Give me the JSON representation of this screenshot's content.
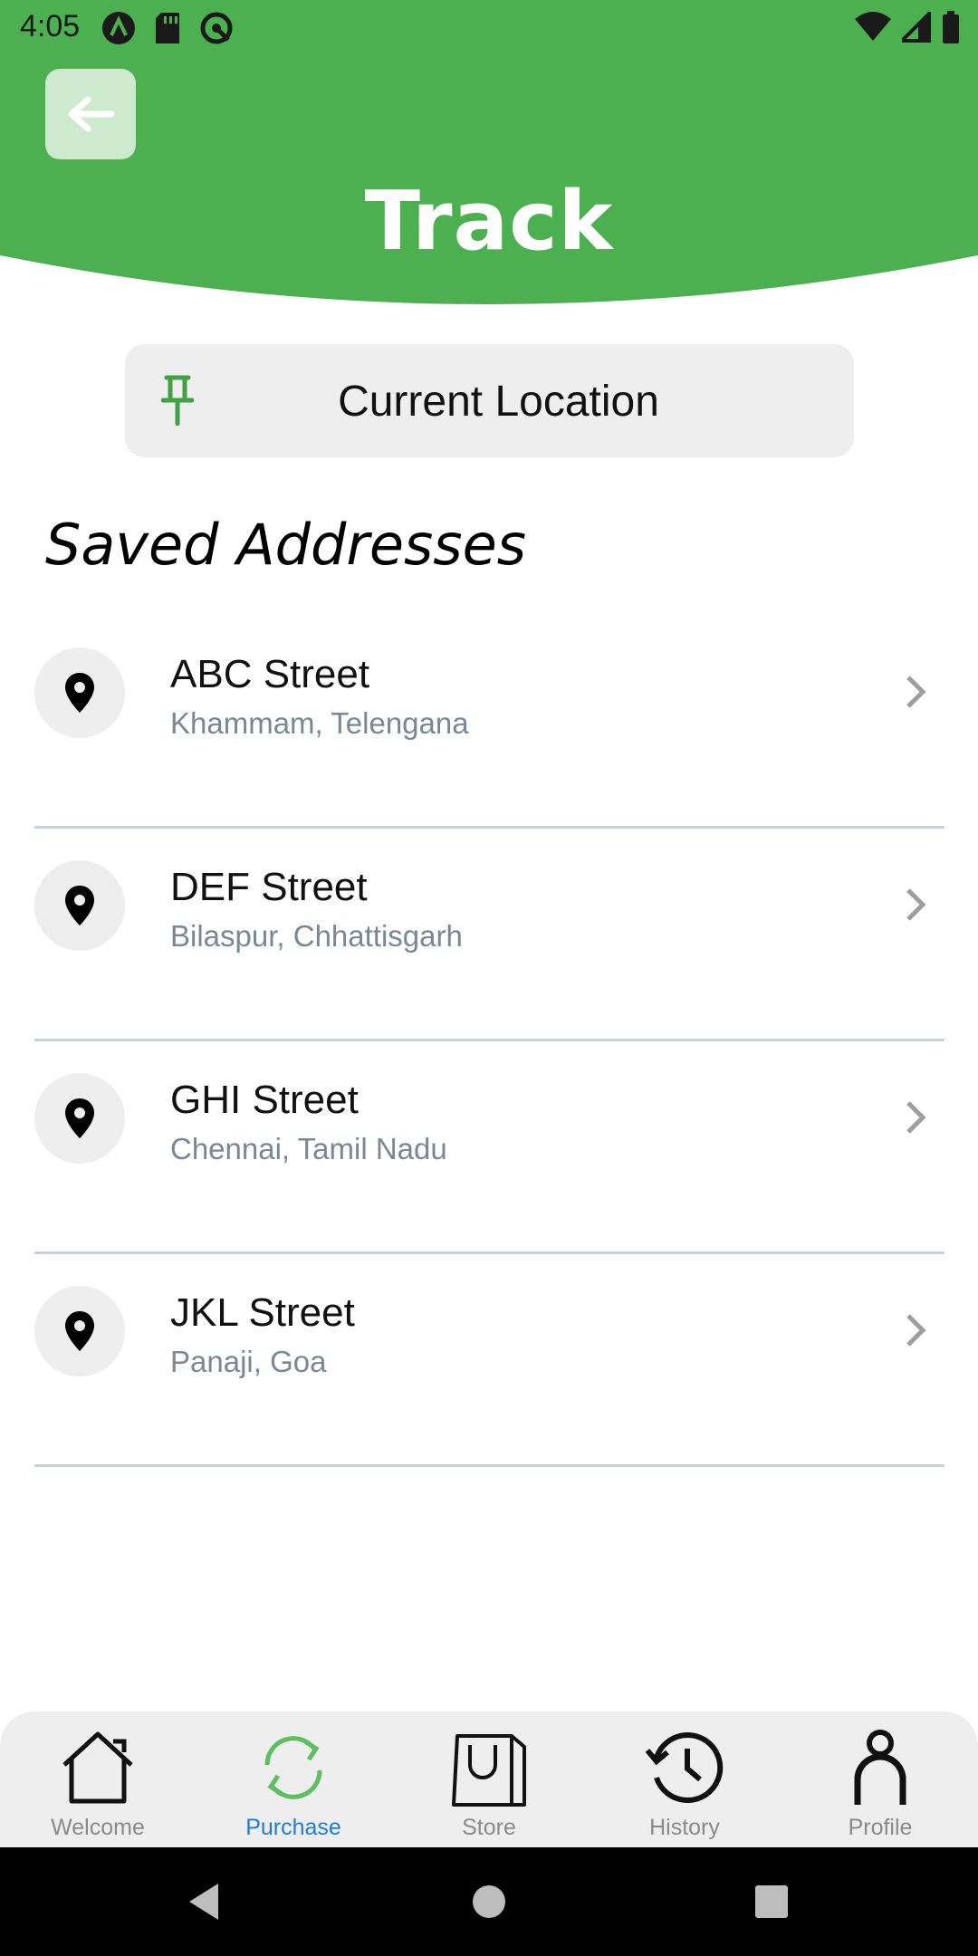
{
  "colors": {
    "brand_green": "#4caf50",
    "active_blue": "#1e7bd8",
    "muted_text": "#7a8794"
  },
  "status_bar": {
    "time": "4:05"
  },
  "header": {
    "title": "Track",
    "back_icon": "arrow-left-icon"
  },
  "current_location": {
    "label": "Current Location",
    "icon": "pushpin-icon"
  },
  "saved_section": {
    "title": "Saved Addresses"
  },
  "addresses": [
    {
      "street": "ABC Street",
      "city": "Khammam, Telengana"
    },
    {
      "street": "DEF Street",
      "city": "Bilaspur, Chhattisgarh"
    },
    {
      "street": "GHI Street",
      "city": "Chennai, Tamil Nadu"
    },
    {
      "street": "JKL Street",
      "city": "Panaji, Goa"
    }
  ],
  "bottom_nav": [
    {
      "label": "Welcome",
      "icon": "home-icon",
      "active": false
    },
    {
      "label": "Purchase",
      "icon": "refresh-icon",
      "active": true
    },
    {
      "label": "Store",
      "icon": "shopping-bag-icon",
      "active": false
    },
    {
      "label": "History",
      "icon": "history-icon",
      "active": false
    },
    {
      "label": "Profile",
      "icon": "person-icon",
      "active": false
    }
  ]
}
